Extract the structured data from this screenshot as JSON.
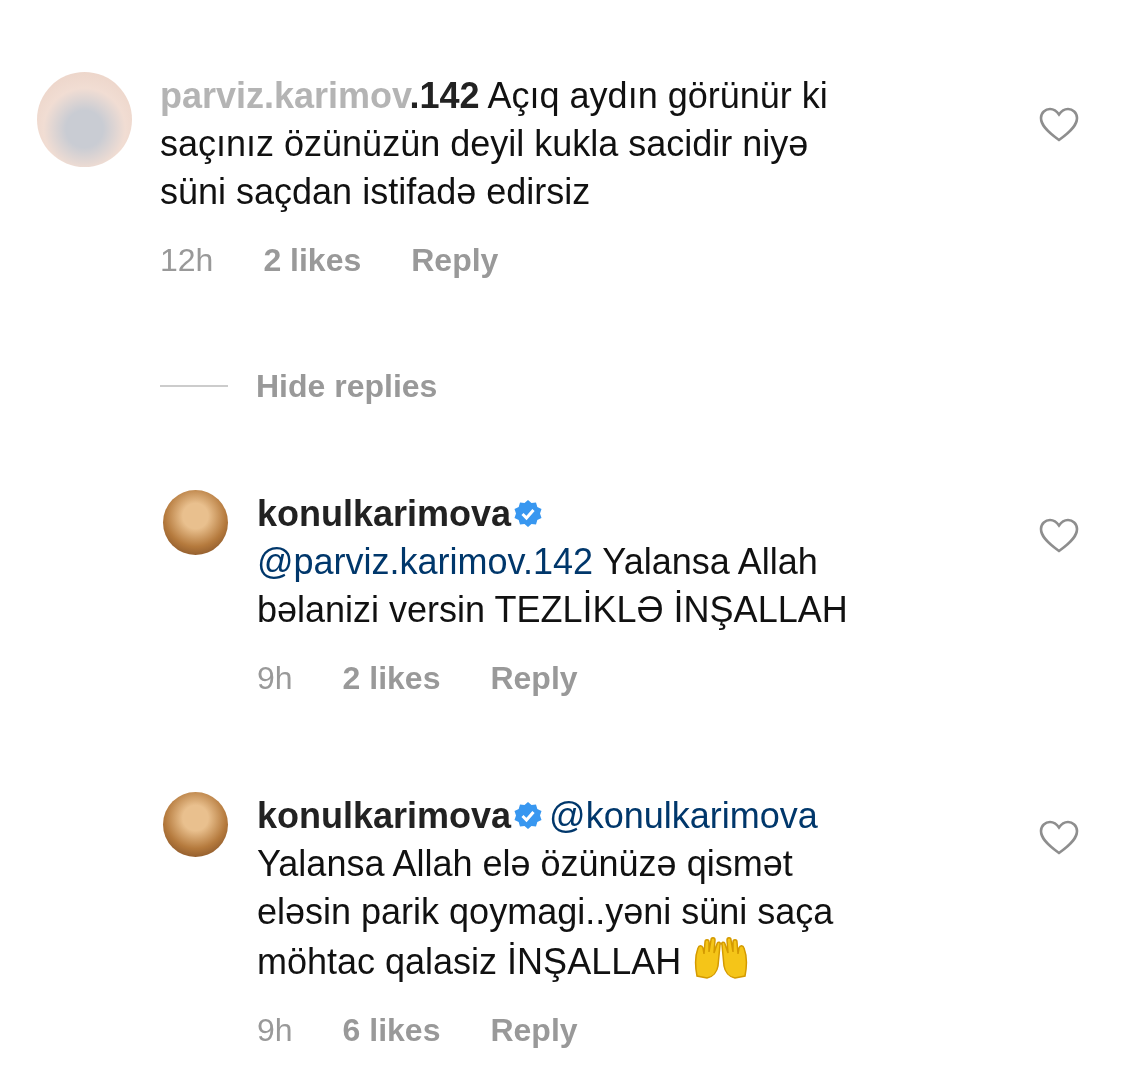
{
  "comments": [
    {
      "username": "parviz.karimov.142",
      "username_faded": true,
      "text": "Açıq aydın görünür ki saçınız özünüzün deyil kukla sacidir niyə süni saçdan istifadə edirsiz",
      "time": "12h",
      "likes": "2 likes",
      "reply_label": "Reply",
      "liked": false,
      "replies_toggle": "Hide replies",
      "replies": [
        {
          "username": "konulkarimova",
          "verified": true,
          "mention": "@parviz.karimov.142",
          "text": "Yalansa Allah bəlanizi versin TEZLİKLƏ İNŞALLAH",
          "time": "9h",
          "likes": "2 likes",
          "reply_label": "Reply",
          "liked": false
        },
        {
          "username": "konulkarimova",
          "verified": true,
          "mention": "@konulkarimova",
          "text": "Yalansa Allah elə özünüzə qismət eləsin parik qoymagi..yəni süni saça möhtac qalasiz İNŞALLAH",
          "time": "9h",
          "likes": "6 likes",
          "reply_label": "Reply",
          "liked": false,
          "emoji": true
        }
      ]
    }
  ]
}
